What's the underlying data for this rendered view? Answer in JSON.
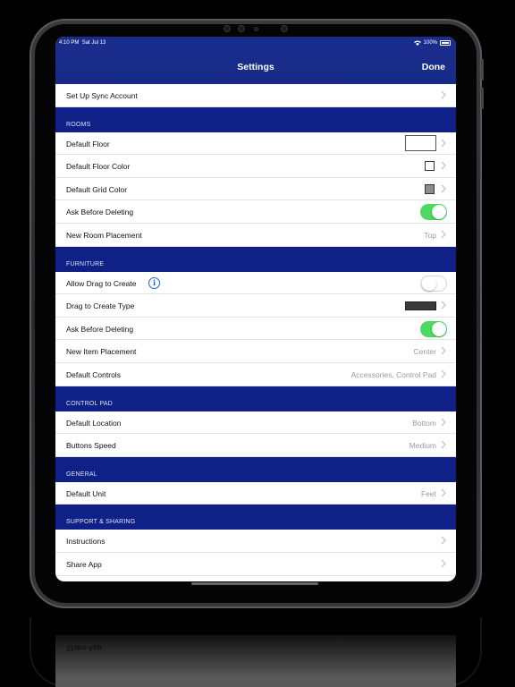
{
  "status": {
    "time": "4:10 PM",
    "date": "Sat Jul 13",
    "battery": "100%"
  },
  "nav": {
    "title": "Settings",
    "done": "Done"
  },
  "sync_row": {
    "label": "Set Up Sync Account"
  },
  "rooms": {
    "header": "ROOMS",
    "default_floor": "Default Floor",
    "default_floor_color": "Default Floor Color",
    "default_floor_color_hex": "#ffffff",
    "default_grid_color": "Default Grid Color",
    "default_grid_color_hex": "#8c8c8c",
    "ask_before_deleting": "Ask Before Deleting",
    "ask_before_deleting_on": true,
    "new_room_placement": "New Room Placement",
    "new_room_placement_value": "Top"
  },
  "furniture": {
    "header": "FURNITURE",
    "allow_drag": "Allow Drag to Create",
    "allow_drag_on": false,
    "drag_type": "Drag to Create Type",
    "ask_before_deleting": "Ask Before Deleting",
    "ask_before_deleting_on": true,
    "new_item_placement": "New Item Placement",
    "new_item_placement_value": "Center",
    "default_controls": "Default Controls",
    "default_controls_value": "Accessories, Control Pad"
  },
  "control_pad": {
    "header": "CONTROL PAD",
    "default_location": "Default Location",
    "default_location_value": "Bottom",
    "buttons_speed": "Buttons Speed",
    "buttons_speed_value": "Medium"
  },
  "general": {
    "header": "GENERAL",
    "default_unit": "Default Unit",
    "default_unit_value": "Feet"
  },
  "support": {
    "header": "SUPPORT & SHARING",
    "instructions": "Instructions",
    "share_app": "Share App"
  },
  "colors": {
    "nav_blue": "#1a2d8c",
    "section_blue": "#0f2186",
    "toggle_on": "#4cd964",
    "info_blue": "#1c63d8"
  },
  "icons": [
    "chevron-right-icon",
    "info-icon",
    "wifi-icon",
    "battery-icon"
  ]
}
